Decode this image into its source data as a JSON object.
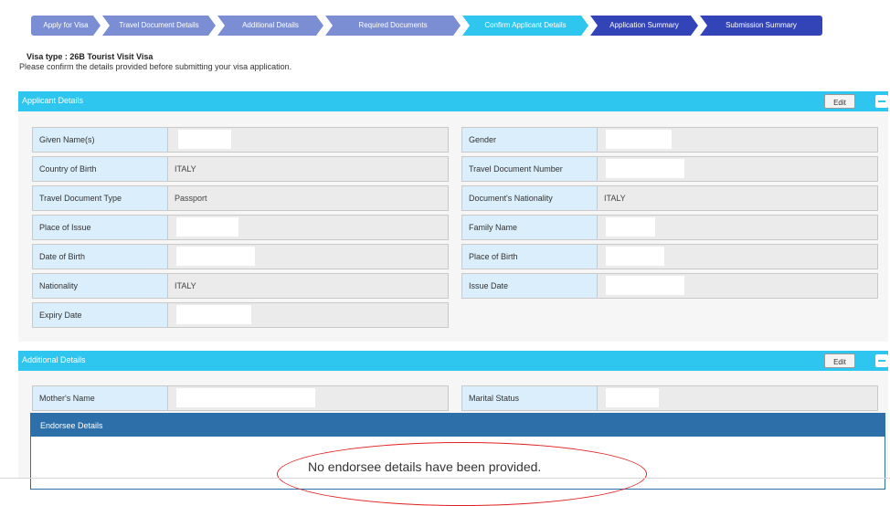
{
  "steps": [
    {
      "label": "Apply for Visa",
      "state": "done"
    },
    {
      "label": "Travel Document Details",
      "state": "done"
    },
    {
      "label": "Additional Details",
      "state": "done"
    },
    {
      "label": "Required Documents",
      "state": "done"
    },
    {
      "label": "Confirm Applicant Details",
      "state": "current"
    },
    {
      "label": "Application Summary",
      "state": "todo"
    },
    {
      "label": "Submission Summary",
      "state": "todo"
    }
  ],
  "visa_type": "Visa type  : 26B Tourist Visit Visa",
  "intro": "Please confirm the details provided before submitting your visa application.",
  "applicant_section": {
    "title": "Applicant Details",
    "edit_label": "Edit",
    "left": [
      {
        "label": "Given Name(s)",
        "value": ""
      },
      {
        "label": "Country of Birth",
        "value": "ITALY"
      },
      {
        "label": "Travel Document Type",
        "value": "Passport"
      },
      {
        "label": "Place of Issue",
        "value": ""
      },
      {
        "label": "Date of Birth",
        "value": ""
      },
      {
        "label": "Nationality",
        "value": "ITALY"
      },
      {
        "label": "Expiry Date",
        "value": ""
      }
    ],
    "right": [
      {
        "label": "Gender",
        "value": ""
      },
      {
        "label": "Travel Document Number",
        "value": ""
      },
      {
        "label": "Document's Nationality",
        "value": "ITALY"
      },
      {
        "label": "Family Name",
        "value": ""
      },
      {
        "label": "Place of Birth",
        "value": ""
      },
      {
        "label": "Issue Date",
        "value": ""
      }
    ]
  },
  "additional_section": {
    "title": "Additional Details",
    "edit_label": "Edit",
    "left": [
      {
        "label": "Mother's Name",
        "value": ""
      }
    ],
    "right": [
      {
        "label": "Marital Status",
        "value": ""
      }
    ]
  },
  "endorsee": {
    "title": "Endorsee Details",
    "message": "No endorsee details have been provided."
  },
  "colors": {
    "step_done": "#7b8ed3",
    "step_current": "#2ec6ef",
    "step_todo": "#3244b8",
    "section_header": "#2ec6ef",
    "endorsee_header": "#2d6fa8",
    "highlight_oval": "#e02020"
  }
}
